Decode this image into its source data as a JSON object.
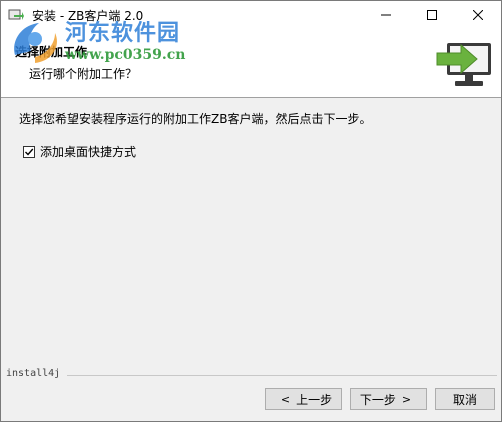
{
  "window": {
    "title": "安装 - ZB客户端 2.0"
  },
  "watermark": {
    "name": "河东软件园",
    "url": "www.pc0359.cn"
  },
  "header": {
    "title": "选择附加工作",
    "subtitle": "运行哪个附加工作？"
  },
  "main": {
    "instruction": "选择您希望安装程序运行的附加工作ZB客户端，然后点击下一步。",
    "checkbox": {
      "label": "添加桌面快捷方式",
      "checked": true
    }
  },
  "footer": {
    "brand": "install4j",
    "buttons": {
      "back": "上一步",
      "next": "下一步",
      "cancel": "取消"
    }
  },
  "icons": {
    "app": "installer-icon",
    "header": "monitor-arrow-icon",
    "minimize": "minimize-icon",
    "maximize": "maximize-icon",
    "close": "close-icon",
    "check": "checkmark-icon"
  },
  "colors": {
    "accent_green": "#6ab23e",
    "monitor_dark": "#3a3a3a",
    "watermark_blue": "#2f7fd8"
  }
}
